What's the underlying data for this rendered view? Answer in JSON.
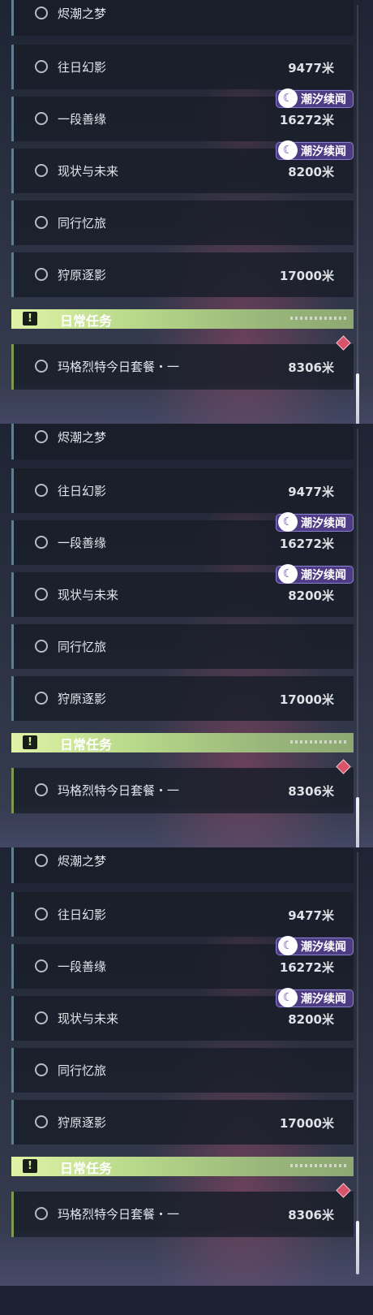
{
  "panels": [
    {
      "quests": [
        {
          "name": "烬潮之梦",
          "distance": "",
          "tag": ""
        },
        {
          "name": "往日幻影",
          "distance": "9477米",
          "tag": ""
        },
        {
          "name": "一段善缘",
          "distance": "16272米",
          "tag": "潮汐续闻"
        },
        {
          "name": "现状与未来",
          "distance": "8200米",
          "tag": "潮汐续闻"
        },
        {
          "name": "同行忆旅",
          "distance": "",
          "tag": ""
        },
        {
          "name": "狩原逐影",
          "distance": "17000米",
          "tag": ""
        }
      ],
      "daily": {
        "header": "日常任务",
        "name": "玛格烈特今日套餐・一",
        "distance": "8306米"
      }
    },
    {
      "quests": [
        {
          "name": "烬潮之梦",
          "distance": "",
          "tag": ""
        },
        {
          "name": "往日幻影",
          "distance": "9477米",
          "tag": ""
        },
        {
          "name": "一段善缘",
          "distance": "16272米",
          "tag": "潮汐续闻"
        },
        {
          "name": "现状与未来",
          "distance": "8200米",
          "tag": "潮汐续闻"
        },
        {
          "name": "同行忆旅",
          "distance": "",
          "tag": ""
        },
        {
          "name": "狩原逐影",
          "distance": "17000米",
          "tag": ""
        }
      ],
      "daily": {
        "header": "日常任务",
        "name": "玛格烈特今日套餐・一",
        "distance": "8306米"
      }
    },
    {
      "quests": [
        {
          "name": "烬潮之梦",
          "distance": "",
          "tag": ""
        },
        {
          "name": "往日幻影",
          "distance": "9477米",
          "tag": ""
        },
        {
          "name": "一段善缘",
          "distance": "16272米",
          "tag": "潮汐续闻"
        },
        {
          "name": "现状与未来",
          "distance": "8200米",
          "tag": "潮汐续闻"
        },
        {
          "name": "同行忆旅",
          "distance": "",
          "tag": ""
        },
        {
          "name": "狩原逐影",
          "distance": "17000米",
          "tag": ""
        }
      ],
      "daily": {
        "header": "日常任务",
        "name": "玛格烈特今日套餐・一",
        "distance": "8306米"
      }
    }
  ],
  "icons": {
    "quest_status": "circle-outline-icon",
    "tag": "sparkle-moon-icon",
    "daily_header": "exclamation-box-icon",
    "pin": "diamond-marker-icon"
  },
  "colors": {
    "tag_bg": "#4d3c84",
    "daily_header": "#c9e494",
    "pin": "#d7546a",
    "row_accent": "#5d7f90"
  }
}
